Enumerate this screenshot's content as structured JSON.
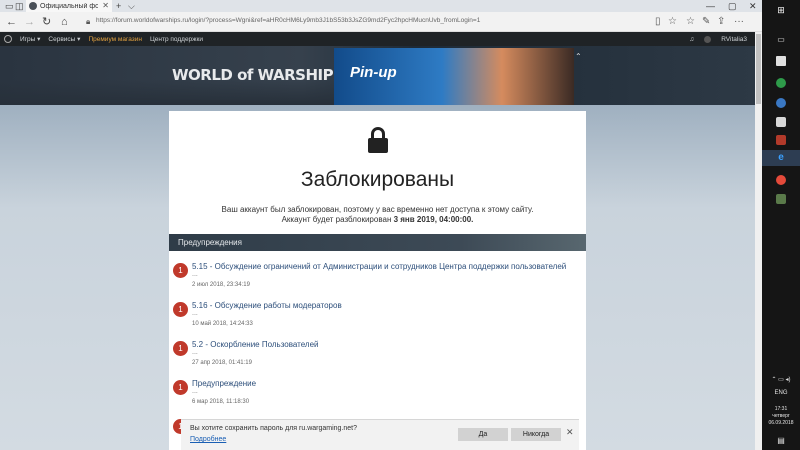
{
  "browser": {
    "tab_title": "Официальный форум",
    "url": "https://forum.worldofwarships.ru/login/?process=Wgni&ref=aHR0cHM6Ly9mb3J1bS53b3JsZG9md2Fyc2hpcHMucnUvb_fromLogin=1",
    "new_tab": "+",
    "tab_menu": "⌵"
  },
  "sitenav": {
    "items": [
      "Игры",
      "Сервисы",
      "Премиум магазин",
      "Центр поддержки"
    ],
    "username": "RVitalia3"
  },
  "banner": {
    "brand": "WORLD of WARSHIPS",
    "promo": "Pin-up"
  },
  "blocked": {
    "title": "Заблокированы",
    "message": "Ваш аккаунт был заблокирован, поэтому у вас временно нет доступа к этому сайту.",
    "until_prefix": "Аккаунт будет разблокирован ",
    "until_date": "3 янв 2019, 04:00:00."
  },
  "warnings": {
    "header": "Предупреждения",
    "items": [
      {
        "points": "1",
        "title": "5.15 - Обсуждение ограничений от Администрации и сотрудников Центра поддержки пользователей",
        "dots": "...",
        "date": "2 июл 2018, 23:34:19"
      },
      {
        "points": "1",
        "title": "5.16 - Обсуждение работы модераторов",
        "dots": "...",
        "date": "10 май 2018, 14:24:33"
      },
      {
        "points": "1",
        "title": "5.2 - Оскорбление Пользователей",
        "dots": "...",
        "date": "27 апр 2018, 01:41:19"
      },
      {
        "points": "1",
        "title": "Предупреждение",
        "dots": "...",
        "date": "6 мар 2018, 11:18:30"
      },
      {
        "points": "1"
      }
    ]
  },
  "password_prompt": {
    "question": "Вы хотите сохранить пароль для ru.wargaming.net?",
    "more": "Подробнее",
    "yes": "Да",
    "never": "Никогда"
  },
  "tray": {
    "lang": "ENG",
    "time": "17:31",
    "day": "четверг",
    "date": "06.09.2018"
  },
  "colors": {
    "badge": "#c0392b",
    "link": "#2c4e7a",
    "nav_bg": "#1f2326",
    "taskbar": "#151515"
  }
}
